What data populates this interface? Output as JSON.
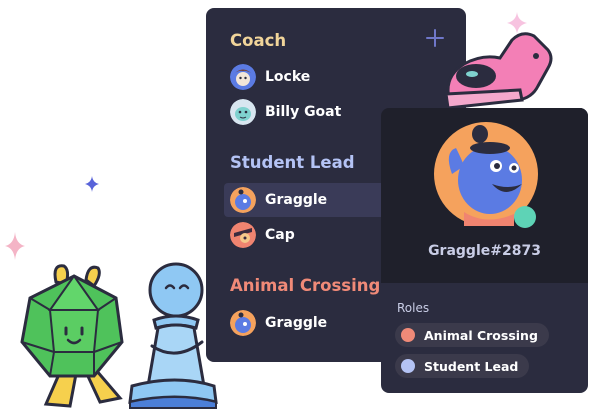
{
  "groups": [
    {
      "title": "Coach",
      "color": "#f1d59a",
      "members": [
        {
          "name": "Locke",
          "avatar_color": "#5b7be3"
        },
        {
          "name": "Billy Goat",
          "avatar_color": "#7fd2cf"
        }
      ]
    },
    {
      "title": "Student Lead",
      "color": "#b4c3f5",
      "members": [
        {
          "name": "Graggle",
          "avatar_color": "#5b7be3",
          "selected": true
        },
        {
          "name": "Cap",
          "avatar_color": "#f08470"
        }
      ]
    },
    {
      "title": "Animal Crossing",
      "color": "#f08a78",
      "members": [
        {
          "name": "Graggle",
          "avatar_color": "#5b7be3"
        }
      ]
    }
  ],
  "add_icon": "plus-icon",
  "profile": {
    "username": "Graggle#2873",
    "status_color": "#5ed3b6",
    "roles_label": "Roles",
    "roles": [
      {
        "name": "Animal Crossing",
        "color": "#f08a78"
      },
      {
        "name": "Student Lead",
        "color": "#b4c3f5"
      }
    ]
  }
}
